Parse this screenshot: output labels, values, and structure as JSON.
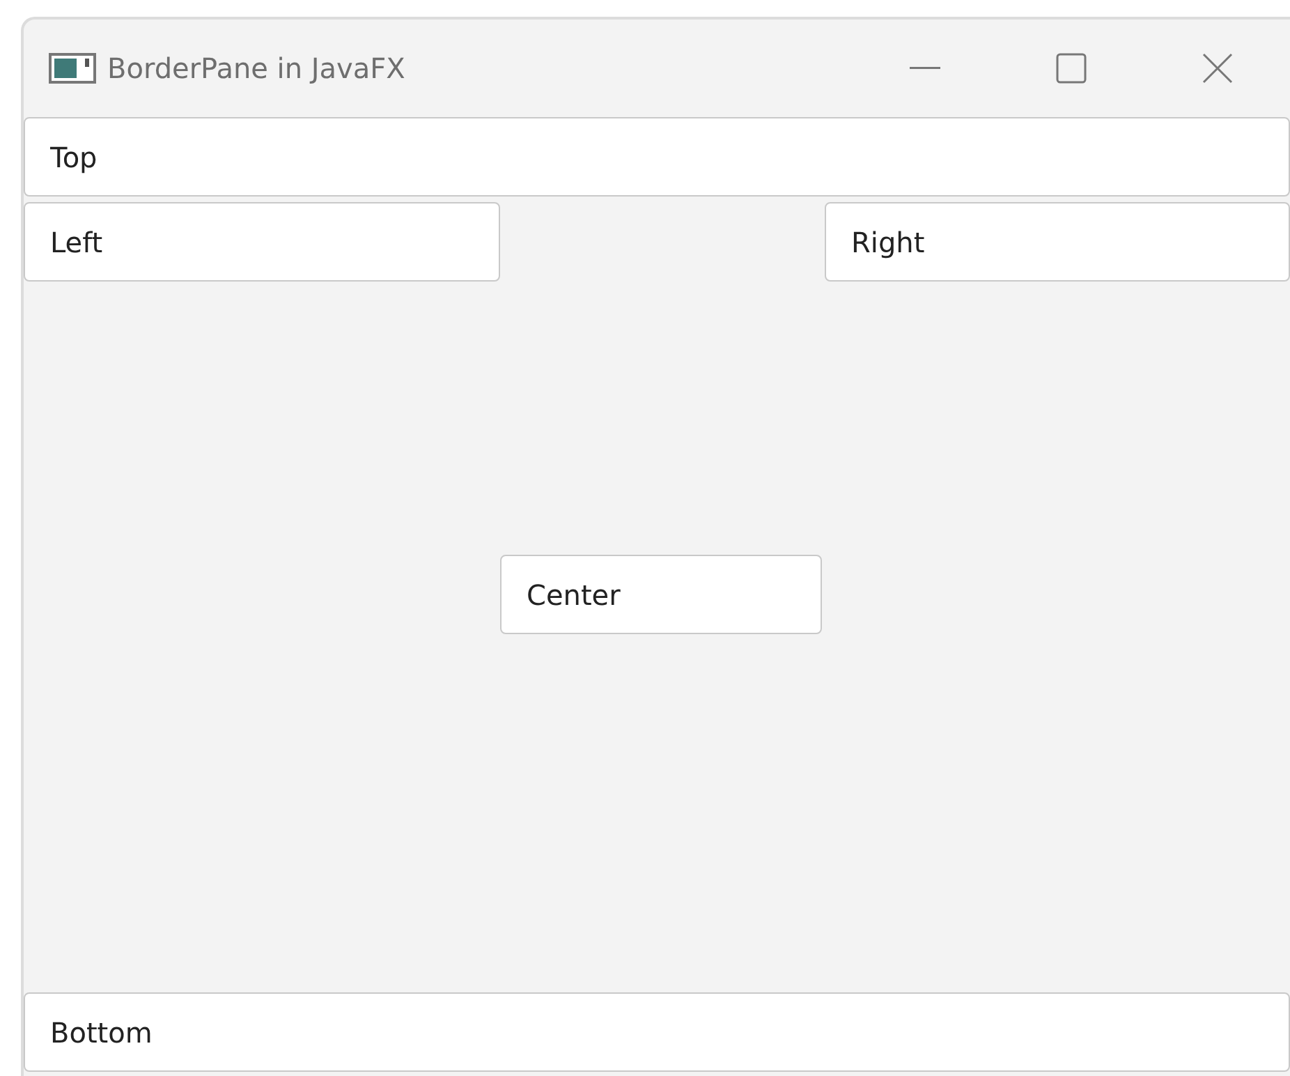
{
  "window": {
    "title": "BorderPane in JavaFX"
  },
  "border_pane": {
    "top": {
      "value": "Top"
    },
    "left": {
      "value": "Left"
    },
    "right": {
      "value": "Right"
    },
    "center": {
      "value": "Center"
    },
    "bottom": {
      "value": "Bottom"
    }
  }
}
